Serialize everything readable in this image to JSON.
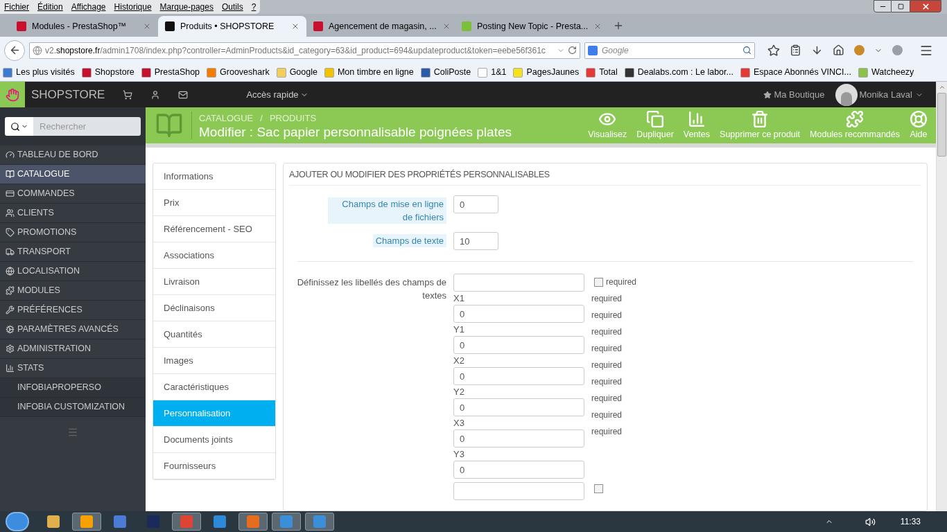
{
  "menu_bar": [
    "Fichier",
    "Édition",
    "Affichage",
    "Historique",
    "Marque-pages",
    "Outils",
    "?"
  ],
  "browser_tabs": [
    {
      "title": "Modules - PrestaShop™",
      "selected": false
    },
    {
      "title": "Produits • SHOPSTORE",
      "selected": true
    },
    {
      "title": "Agencement de magasin, ...",
      "selected": false
    },
    {
      "title": "Posting New Topic - Presta...",
      "selected": false
    }
  ],
  "address_bar": {
    "url": "v2.**shopstore.fr**/admin1708/index.php?controller=AdminProducts&id_category=63&id_product=694&updateproduct&token=eebe56f361c"
  },
  "search_box": {
    "placeholder": "Google"
  },
  "bookmarks": [
    "Les plus visités",
    "Shopstore",
    "PrestaShop",
    "Grooveshark",
    "Google",
    "Mon timbre en ligne",
    "ColiPoste",
    "1&1",
    "PagesJaunes",
    "Total",
    "Dealabs.com : Le labor...",
    "Espace Abonnés VINCI...",
    "Watcheezy"
  ],
  "app_header": {
    "brand": "SHOPSTORE",
    "quick_access": "Accès rapide",
    "shop_link": "Ma Boutique",
    "user": "Monika Laval"
  },
  "sidebar": {
    "search_placeholder": "Rechercher",
    "items": [
      {
        "kind": "main",
        "label": "TABLEAU DE BORD",
        "selected": false
      },
      {
        "kind": "main",
        "label": "CATALOGUE",
        "selected": true
      },
      {
        "kind": "main",
        "label": "COMMANDES",
        "selected": false
      },
      {
        "kind": "main",
        "label": "CLIENTS",
        "selected": false
      },
      {
        "kind": "main",
        "label": "PROMOTIONS",
        "selected": false
      },
      {
        "kind": "main",
        "label": "TRANSPORT",
        "selected": false
      },
      {
        "kind": "main",
        "label": "LOCALISATION",
        "selected": false
      },
      {
        "kind": "main",
        "label": "MODULES",
        "selected": false
      },
      {
        "kind": "main",
        "label": "PRÉFÉRENCES",
        "selected": false
      },
      {
        "kind": "main",
        "label": "PARAMÈTRES AVANCÉS",
        "selected": false
      },
      {
        "kind": "main",
        "label": "ADMINISTRATION",
        "selected": false
      },
      {
        "kind": "main",
        "label": "STATS",
        "selected": false
      },
      {
        "kind": "sub",
        "label": "INFOBIAPROPERSO",
        "selected": false
      },
      {
        "kind": "sub",
        "label": "INFOBIA CUSTOMIZATION",
        "selected": false
      }
    ]
  },
  "toolbar": {
    "breadcrumb": [
      "CATALOGUE",
      "PRODUITS"
    ],
    "breadcrumb_separator": "/",
    "title": "Modifier : Sac papier personnalisable poignées plates",
    "actions": [
      "Visualisez",
      "Dupliquer",
      "Ventes",
      "Supprimer ce produit",
      "Modules recommandés",
      "Aide"
    ]
  },
  "product_tabs": [
    {
      "label": "Informations",
      "selected": false
    },
    {
      "label": "Prix",
      "selected": false
    },
    {
      "label": "Référencement - SEO",
      "selected": false
    },
    {
      "label": "Associations",
      "selected": false
    },
    {
      "label": "Livraison",
      "selected": false
    },
    {
      "label": "Déclinaisons",
      "selected": false
    },
    {
      "label": "Quantités",
      "selected": false
    },
    {
      "label": "Images",
      "selected": false
    },
    {
      "label": "Caractéristiques",
      "selected": false
    },
    {
      "label": "Personnalisation",
      "selected": true
    },
    {
      "label": "Documents joints",
      "selected": false
    },
    {
      "label": "Fournisseurs",
      "selected": false
    }
  ],
  "panel": {
    "heading": "AJOUTER OU MODIFIER DES PROPRIÉTÉS PERSONNALISABLES",
    "fields": [
      {
        "label": "Champs de mise en ligne de fichiers",
        "value": "0"
      },
      {
        "label": "Champs de texte",
        "value": "10"
      }
    ],
    "labels_section": {
      "label": "Définissez les libellés des champs de textes",
      "entries": [
        {
          "kind": "input"
        },
        {
          "kind": "caption",
          "text": "X1"
        },
        {
          "kind": "input",
          "value": "0"
        },
        {
          "kind": "caption",
          "text": "Y1"
        },
        {
          "kind": "input",
          "value": "0"
        },
        {
          "kind": "caption",
          "text": "X2"
        },
        {
          "kind": "input",
          "value": "0"
        },
        {
          "kind": "caption",
          "text": "Y2"
        },
        {
          "kind": "input",
          "value": "0"
        },
        {
          "kind": "caption",
          "text": "X3"
        },
        {
          "kind": "input",
          "value": "0"
        },
        {
          "kind": "caption",
          "text": "Y3"
        },
        {
          "kind": "input",
          "value": "0"
        },
        {
          "kind": "input"
        }
      ],
      "required_marks": [
        {
          "kind": "checkbox",
          "checked": false,
          "text": "required"
        },
        {
          "kind": "text",
          "text": "required"
        },
        {
          "kind": "text",
          "text": "required"
        },
        {
          "kind": "text",
          "text": "required"
        },
        {
          "kind": "text",
          "text": "required"
        },
        {
          "kind": "text",
          "text": "required"
        },
        {
          "kind": "text",
          "text": "required"
        },
        {
          "kind": "text",
          "text": "required"
        },
        {
          "kind": "text",
          "text": "required"
        },
        {
          "kind": "text",
          "text": "required"
        },
        {
          "kind": "checkbox",
          "checked": false
        }
      ]
    }
  },
  "taskbar": {
    "clock": "11:33"
  }
}
